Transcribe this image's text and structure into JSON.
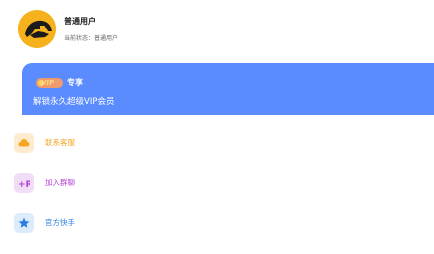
{
  "profile": {
    "username": "普通用户",
    "status_label": "当前状态：",
    "status_value": "普通用户"
  },
  "vip_card": {
    "badge_text": "VIP",
    "exclusive_label": "专享",
    "description": "解锁永久超级VIP会员",
    "background_color": "#5b8cff"
  },
  "menu": {
    "items": [
      {
        "label": "联系客服",
        "icon": "cloud-icon",
        "color": "#f5a623",
        "bg": "#fdebd0"
      },
      {
        "label": "加入群聊",
        "icon": "group-chat-icon",
        "color": "#b73fd8",
        "bg": "#f0ddf6"
      },
      {
        "label": "官方快手",
        "icon": "star-icon",
        "color": "#2a7de1",
        "bg": "#dcecfb"
      }
    ]
  }
}
